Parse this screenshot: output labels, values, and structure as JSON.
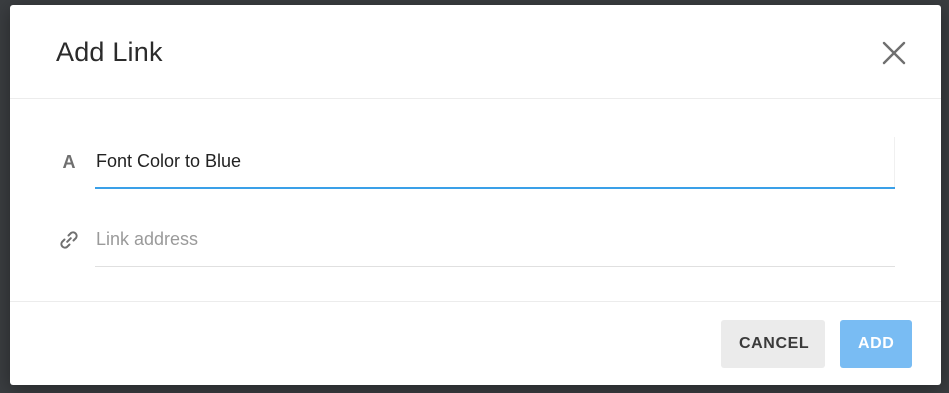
{
  "dialog": {
    "title": "Add Link",
    "close_icon": "close-icon",
    "text_field": {
      "icon": "text-format-icon",
      "icon_glyph": "A",
      "value": "Font Color to Blue",
      "placeholder": ""
    },
    "link_field": {
      "icon": "link-icon",
      "value": "",
      "placeholder": "Link address"
    },
    "buttons": {
      "cancel_label": "CANCEL",
      "add_label": "ADD"
    }
  },
  "colors": {
    "accent": "#3aa0e8",
    "add_button": "#79bcf3",
    "cancel_button": "#ebebeb",
    "backdrop": "#3a3d40"
  }
}
